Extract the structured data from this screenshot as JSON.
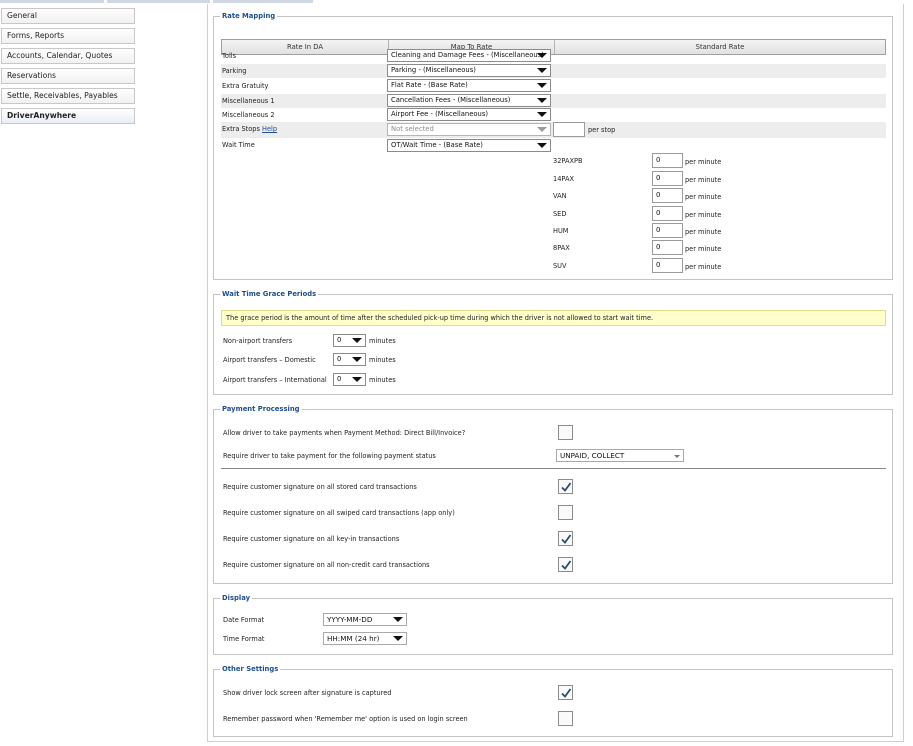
{
  "sidebar": {
    "items": [
      {
        "label": "General"
      },
      {
        "label": "Forms, Reports"
      },
      {
        "label": "Accounts, Calendar, Quotes"
      },
      {
        "label": "Reservations"
      },
      {
        "label": "Settle, Receivables, Payables"
      },
      {
        "label": "DriverAnywhere"
      }
    ]
  },
  "rate_mapping": {
    "legend": "Rate Mapping",
    "headers": {
      "rate_in_da": "Rate In DA",
      "map_to_rate": "Map To Rate",
      "standard_rate": "Standard Rate"
    },
    "rows": [
      {
        "label": "Tolls",
        "value": "Cleaning and Damage Fees - (Miscellaneous)"
      },
      {
        "label": "Parking",
        "value": "Parking - (Miscellaneous)"
      },
      {
        "label": "Extra Gratuity",
        "value": "Flat Rate - (Base Rate)"
      },
      {
        "label": "Miscellaneous 1",
        "value": "Cancellation Fees - (Miscellaneous)"
      },
      {
        "label": "Miscellaneous 2",
        "value": "Airport Fee - (Miscellaneous)"
      }
    ],
    "extra_stops": {
      "label": "Extra Stops",
      "help": "Help",
      "placeholder": "Not selected",
      "value": "",
      "unit": "per stop"
    },
    "wait_time": {
      "label": "Wait Time",
      "value": "OT/Wait Time - (Base Rate)",
      "unit": "per minute",
      "vehicles": [
        {
          "name": "32PAXPB",
          "value": "0"
        },
        {
          "name": "14PAX",
          "value": "0"
        },
        {
          "name": "VAN",
          "value": "0"
        },
        {
          "name": "SED",
          "value": "0"
        },
        {
          "name": "HUM",
          "value": "0"
        },
        {
          "name": "8PAX",
          "value": "0"
        },
        {
          "name": "SUV",
          "value": "0"
        }
      ]
    }
  },
  "grace": {
    "legend": "Wait Time Grace Periods",
    "note": "The grace period is the amount of time after the scheduled pick-up time during which the driver is not allowed to start wait time.",
    "unit": "minutes",
    "rows": [
      {
        "label": "Non-airport transfers",
        "value": "0"
      },
      {
        "label": "Airport transfers – Domestic",
        "value": "0"
      },
      {
        "label": "Airport transfers – International",
        "value": "0"
      }
    ]
  },
  "payment": {
    "legend": "Payment Processing",
    "allow_direct_bill": {
      "label": "Allow driver to take payments when Payment Method: Direct Bill/Invoice?",
      "checked": false
    },
    "require_status": {
      "label": "Require driver to take payment for the following payment status",
      "value": "UNPAID, COLLECT"
    },
    "signatures": [
      {
        "label": "Require customer signature on all stored card transactions",
        "checked": true
      },
      {
        "label": "Require customer signature on all swiped card transactions (app only)",
        "checked": false
      },
      {
        "label": "Require customer signature on all key-in transactions",
        "checked": true
      },
      {
        "label": "Require customer signature on all non-credit card transactions",
        "checked": true
      }
    ]
  },
  "display": {
    "legend": "Display",
    "date_format": {
      "label": "Date Format",
      "value": "YYYY-MM-DD"
    },
    "time_format": {
      "label": "Time Format",
      "value": "HH:MM (24 hr)"
    }
  },
  "other": {
    "legend": "Other Settings",
    "items": [
      {
        "label": "Show driver lock screen after signature is captured",
        "checked": true
      },
      {
        "label": "Remember password when 'Remember me' option is used on login screen",
        "checked": false
      }
    ]
  }
}
